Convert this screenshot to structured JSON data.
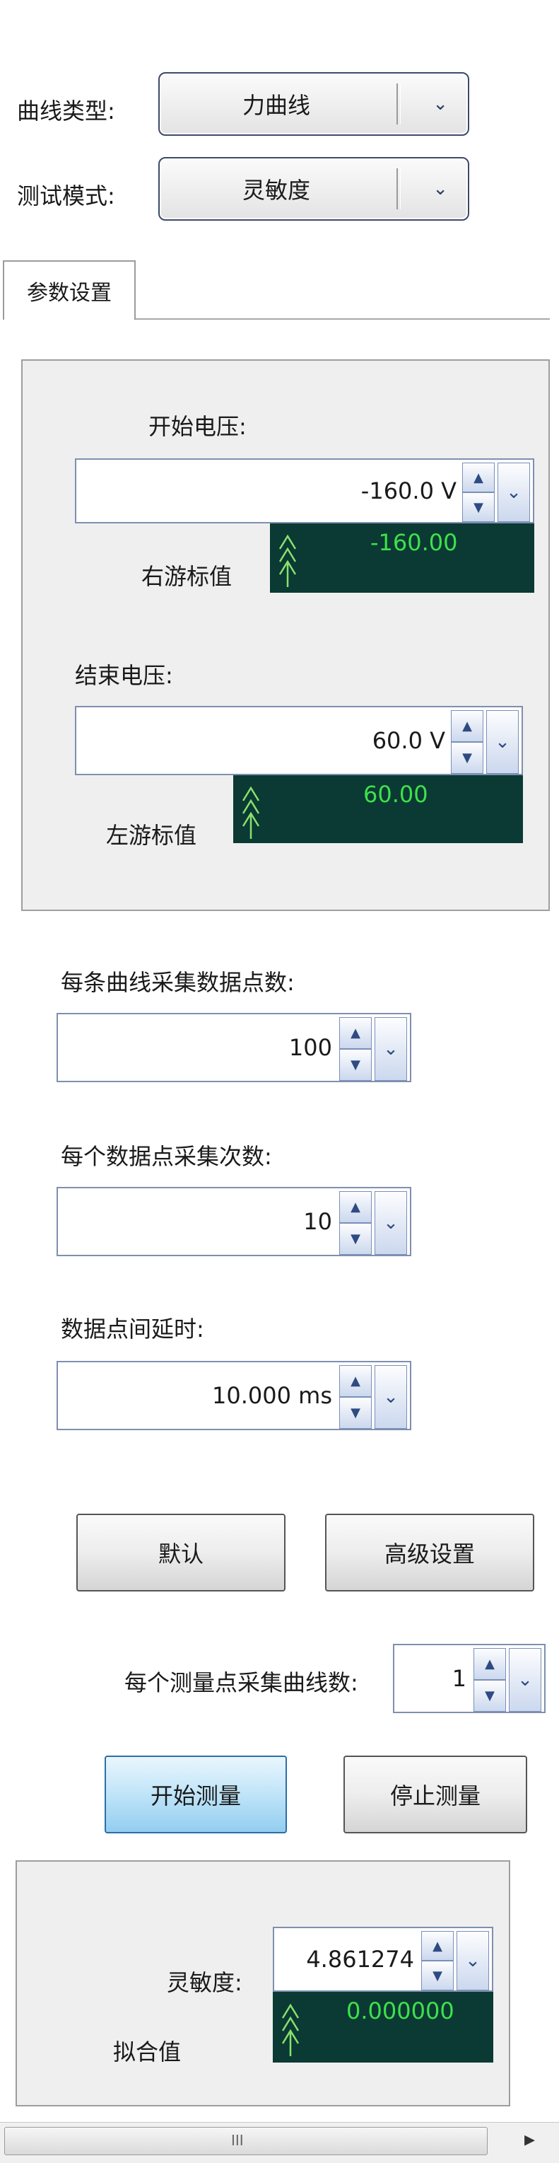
{
  "header": {
    "curve_type_label": "曲线类型:",
    "curve_type_value": "力曲线",
    "test_mode_label": "测试模式:",
    "test_mode_value": "灵敏度"
  },
  "tabs": [
    {
      "label": "参数设置"
    }
  ],
  "voltage_group": {
    "start_label": "开始电压:",
    "start_value": "-160.0 V",
    "right_cursor_label": "右游标值",
    "right_cursor_value": "-160.00",
    "end_label": "结束电压:",
    "end_value": "60.0 V",
    "left_cursor_label": "左游标值",
    "left_cursor_value": "60.00"
  },
  "params": {
    "points_per_curve_label": "每条曲线采集数据点数:",
    "points_per_curve_value": "100",
    "samples_per_point_label": "每个数据点采集次数:",
    "samples_per_point_value": "10",
    "point_delay_label": "数据点间延时:",
    "point_delay_value": "10.000 ms"
  },
  "buttons": {
    "default": "默认",
    "advanced": "高级设置",
    "start": "开始测量",
    "stop": "停止测量"
  },
  "curves_per_point": {
    "label": "每个测量点采集曲线数:",
    "value": "1"
  },
  "result_group": {
    "sensitivity_label": "灵敏度:",
    "sensitivity_value": "4.861274",
    "fit_label": "拟合值",
    "fit_value": "0.000000"
  },
  "scrollbar": {
    "thumb_glyph": "III",
    "right_arrow": "▸"
  },
  "colors": {
    "gauge_bg": "#0a3a33",
    "gauge_text": "#3fe04b",
    "accent_button": "#93cdf0"
  }
}
